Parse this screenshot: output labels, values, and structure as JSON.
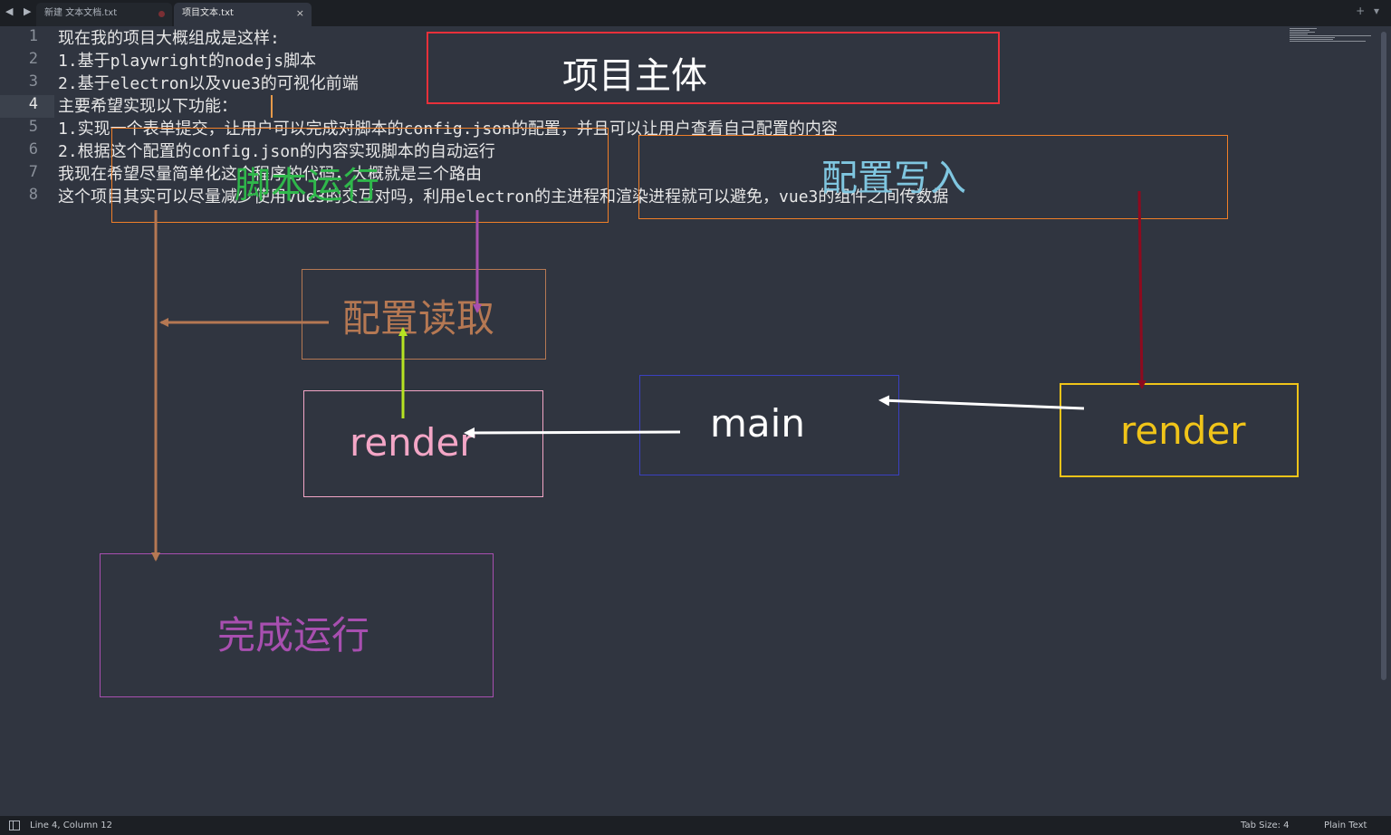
{
  "tabs": {
    "nav_glyph": "◀ ▶",
    "items": [
      {
        "label": "新建 文本文档.txt"
      },
      {
        "label": "项目文本.txt",
        "close": "×"
      }
    ],
    "right_glyph": "+ ▾"
  },
  "editor": {
    "line_numbers": [
      "1",
      "2",
      "3",
      "4",
      "5",
      "6",
      "7",
      "8"
    ],
    "current_line": 4,
    "lines": [
      "现在我的项目大概组成是这样:",
      "1.基于playwright的nodejs脚本",
      "2.基于electron以及vue3的可视化前端",
      "主要希望实现以下功能：",
      "1.实现一个表单提交，让用户可以完成对脚本的config.json的配置，并且可以让用户查看自己配置的内容",
      "2.根据这个配置的config.json的内容实现脚本的自动运行",
      "我现在希望尽量简单化这个程序的代码，大概就是三个路由",
      "这个项目其实可以尽量减少使用vue3的交互对吗，利用electron的主进程和渲染进程就可以避免，vue3的组件之间传数据"
    ]
  },
  "diagram": {
    "boxes": [
      {
        "id": "project-main",
        "label": "项目主体",
        "color": "#e8303a",
        "label_color": "#ffffff"
      },
      {
        "id": "script-run",
        "label": "脚本运行",
        "color": "#f07f28",
        "label_color": "#2fb84b"
      },
      {
        "id": "config-write",
        "label": "配置写入",
        "color": "#f07f28",
        "label_color": "#7fc6e0"
      },
      {
        "id": "config-read",
        "label": "配置读取",
        "color": "#b57853",
        "label_color": "#b57853"
      },
      {
        "id": "render-left",
        "label": "render",
        "color": "#f3a6c6",
        "label_color": "#f3a6c6"
      },
      {
        "id": "main",
        "label": "main",
        "color": "#3a40c0",
        "label_color": "#ffffff"
      },
      {
        "id": "render-right",
        "label": "render",
        "color": "#f0c419",
        "label_color": "#f0c419"
      },
      {
        "id": "done-run",
        "label": "完成运行",
        "color": "#a84fb0",
        "label_color": "#a84fb0"
      }
    ],
    "arrow_colors": {
      "brown": "#b57853",
      "purple": "#a84fb0",
      "lime": "#b6e322",
      "white": "#ffffff",
      "darkred": "#8e0a1e"
    }
  },
  "status": {
    "position": "Line 4, Column 12",
    "tab_size": "Tab Size: 4",
    "syntax": "Plain Text"
  }
}
